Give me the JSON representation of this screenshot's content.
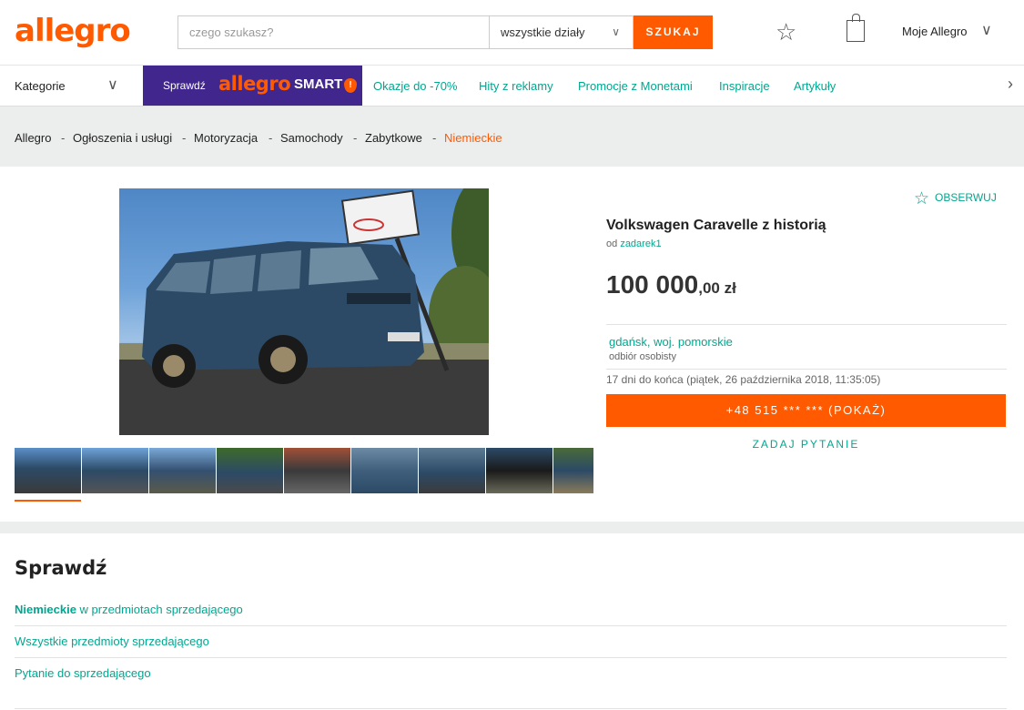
{
  "header": {
    "logo": "allegro",
    "search_placeholder": "czego szukasz?",
    "dept_label": "wszystkie działy",
    "search_button": "SZUKAJ",
    "account_label": "Moje Allegro"
  },
  "nav": {
    "categories_label": "Kategorie",
    "smart_prefix": "Sprawdź",
    "smart_brand": "allegro",
    "smart_word": "SMART",
    "smart_badge": "!",
    "links": [
      "Okazje do -70%",
      "Hity z reklamy",
      "Promocje z Monetami",
      "Inspiracje",
      "Artykuły"
    ]
  },
  "breadcrumb": {
    "items": [
      "Allegro",
      "Ogłoszenia i usługi",
      "Motoryzacja",
      "Samochody",
      "Zabytkowe",
      "Niemieckie"
    ],
    "separator": "-"
  },
  "offer": {
    "observe_label": "OBSERWUJ",
    "title": "Volkswagen Caravelle z historią",
    "seller_prefix": "od",
    "seller_name": "zadarek1",
    "price_main": "100 000",
    "price_cents": ",00 zł",
    "location": "gdańsk, woj. pomorskie",
    "pickup": "odbiór osobisty",
    "ends": "17 dni do końca (piątek, 26 października 2018, 11:35:05)",
    "phone_button": "+48 515 *** *** (POKAŻ)",
    "ask_button": "ZADAJ PYTANIE",
    "thumbnail_count": 9,
    "selected_thumbnail": 1
  },
  "check": {
    "heading": "Sprawdź",
    "row1_bold": "Niemieckie",
    "row1_rest": " w przedmiotach sprzedającego",
    "row2": "Wszystkie przedmioty sprzedającego",
    "row3": "Pytanie do sprzedającego"
  },
  "colors": {
    "brand_orange": "#ff5a00",
    "link_teal": "#00a790",
    "smart_purple": "#41268e"
  }
}
